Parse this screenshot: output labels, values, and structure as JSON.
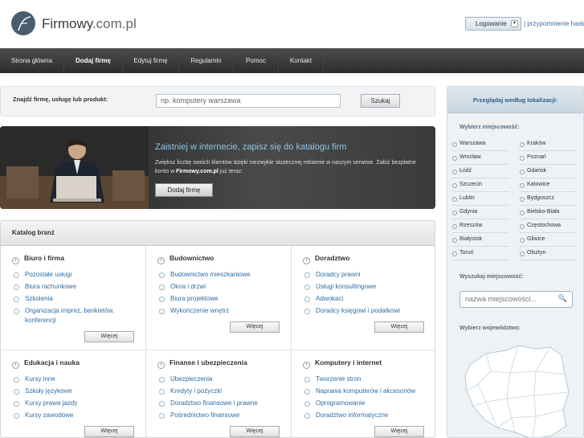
{
  "header": {
    "logo_main": "Firmowy",
    "logo_suffix": ".com.pl",
    "login_label": "Logowanie",
    "login_caret": "▾",
    "forgot_link": "| przypomnienie hasła"
  },
  "nav": {
    "items": [
      "Strona główna",
      "Dodaj firmę",
      "Edytuj firmę",
      "Regulamin",
      "Pomoc",
      "Kontakt"
    ],
    "active_index": 1
  },
  "search": {
    "label": "Znajdź firmę, usługę lub produkt:",
    "value": "np. komputery warszawa",
    "button": "Szukaj"
  },
  "banner": {
    "title": "Zaistniej w internecie, zapisz się do katalogu firm",
    "text_pre": "Zwiększ liczbę swoich klientów dzięki niezwykle skutecznej reklamie w naszym serwisie. Załóż bezpłatne konto w ",
    "text_bold": "Firmowy.com.pl",
    "text_post": " już teraz:",
    "button": "Dodaj firmę"
  },
  "catalog": {
    "heading": "Katalog branż",
    "bullet_glyph": "›",
    "more_label": "Więcej",
    "categories": [
      {
        "title": "Biuro i firma",
        "items": [
          "Pozostałe usługi",
          "Biura rachunkowe",
          "Szkolenia",
          "Organizacja imprez, bankietów, konferencji"
        ]
      },
      {
        "title": "Budownictwo",
        "items": [
          "Budownictwo mieszkaniowe",
          "Okna i drzwi",
          "Biura projektowe",
          "Wykończenie wnętrz"
        ]
      },
      {
        "title": "Doradztwo",
        "items": [
          "Doradcy prawni",
          "Usługi konsultingowe",
          "Adwokaci",
          "Doradcy księgowi i podatkowi"
        ]
      },
      {
        "title": "Edukacja i nauka",
        "items": [
          "Kursy inne",
          "Szkoły językowe",
          "Kursy prawa jazdy",
          "Kursy zawodowe"
        ]
      },
      {
        "title": "Finanse i ubezpieczenia",
        "items": [
          "Ubezpieczenia",
          "Kredyty i pożyczki",
          "Doradztwo finansowe i prawne",
          "Pośrednictwo finansowe"
        ]
      },
      {
        "title": "Komputery i internet",
        "items": [
          "Tworzenie stron",
          "Naprawa komputerów i akcesoriów",
          "Oprogramowanie",
          "Doradztwo informatyczne"
        ]
      }
    ]
  },
  "sidebar": {
    "heading": "Przeglądaj według lokalizacji:",
    "cities_label": "Wybierz miejscowość:",
    "cities": [
      "Warszawa",
      "Kraków",
      "Wrocław",
      "Poznań",
      "Łódź",
      "Gdańsk",
      "Szczecin",
      "Katowice",
      "Lublin",
      "Bydgoszcz",
      "Gdynia",
      "Bielsko-Biała",
      "Rzeszów",
      "Częstochowa",
      "Białystok",
      "Gliwice",
      "Toruń",
      "Olsztyn"
    ],
    "search_label": "Wyszukaj miejscowość:",
    "search_placeholder": "nazwa miejscowości...",
    "search_icon": "🔍",
    "region_label": "Wybierz województwo:"
  },
  "icons": {
    "logo": "logo-f-icon",
    "search": "magnifier-icon"
  },
  "colors": {
    "nav_bg": "#333333",
    "link": "#2f6ea5",
    "banner_title": "#8ec6e8",
    "sidebar_heading": "#2f5f88"
  }
}
